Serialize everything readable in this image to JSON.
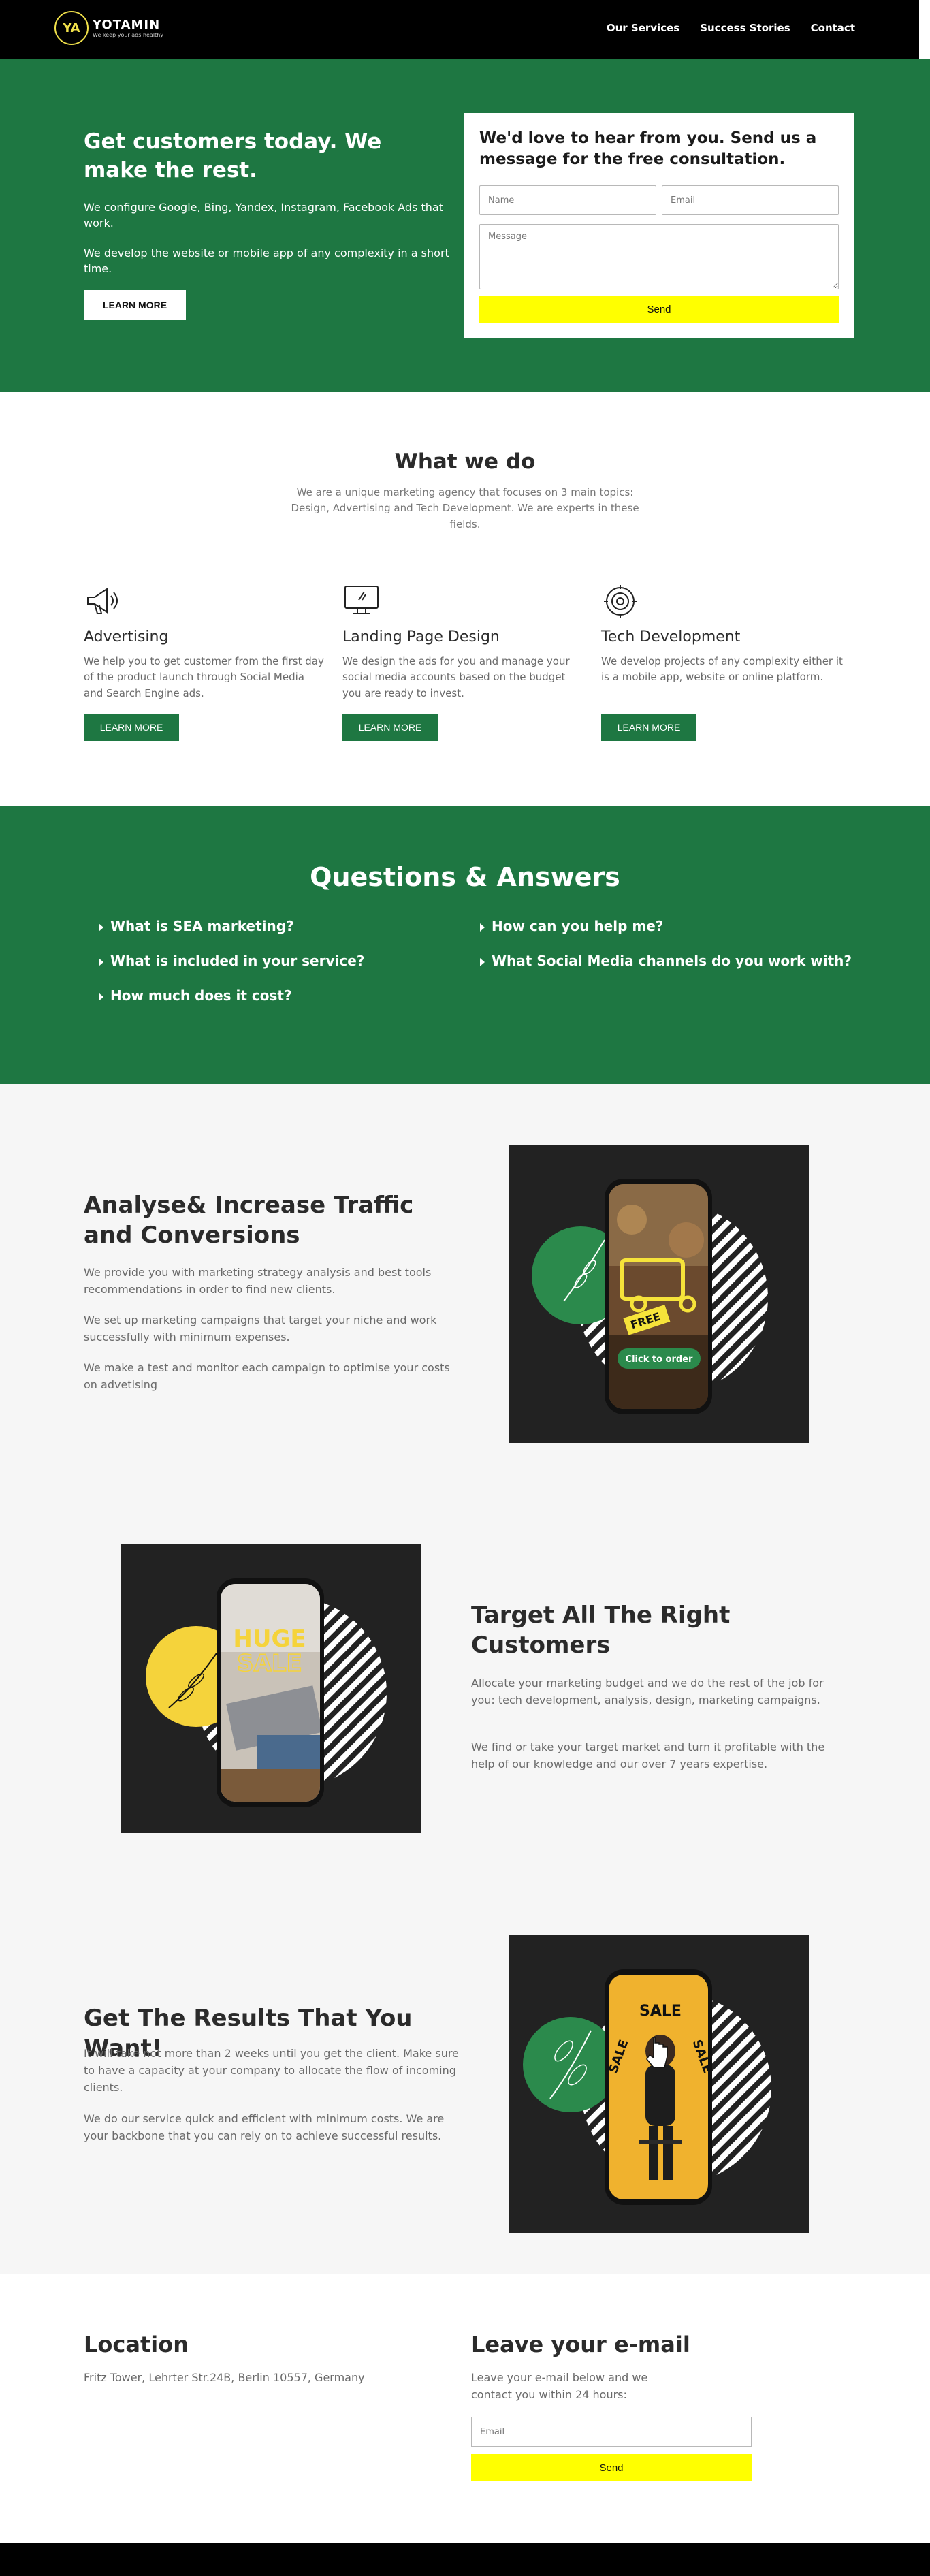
{
  "header": {
    "logo_mark": "YA",
    "logo_name": "YOTAMIN",
    "logo_tagline": "We keep your ads healthy",
    "nav": [
      "Our Services",
      "Success Stories",
      "Contact"
    ]
  },
  "hero": {
    "title": "Get customers today. We make the rest.",
    "p1": "We configure Google, Bing, Yandex, Instagram, Facebook Ads that work.",
    "p2": "We develop the website or mobile app of any complexity in a short time.",
    "button": "LEARN MORE"
  },
  "contact_form": {
    "title": "We'd love to hear from you. Send us a message for the free consultation.",
    "name_placeholder": "Name",
    "email_placeholder": "Email",
    "message_placeholder": "Message",
    "send": "Send"
  },
  "what_we_do": {
    "title": "What we do",
    "subtitle": "We are a unique marketing agency that focuses on 3 main topics: Design, Advertising and Tech Development. We are experts in these fields.",
    "services": [
      {
        "icon": "megaphone-icon",
        "title": "Advertising",
        "desc": "We help you to get customer from the first day of the product launch through Social Media and Search Engine ads.",
        "button": "LEARN MORE"
      },
      {
        "icon": "monitor-icon",
        "title": "Landing Page Design",
        "desc": "We design the ads for you and manage your social media accounts based on the budget you are ready to invest.",
        "button": "LEARN MORE"
      },
      {
        "icon": "gear-icon",
        "title": "Tech Development",
        "desc": "We develop projects of any complexity either it is a mobile app, website or online platform.",
        "button": "LEARN MORE"
      }
    ]
  },
  "qa": {
    "title": "Questions & Answers",
    "left": [
      "What is SEA marketing?",
      "What is included in your service?",
      "How much does it cost?"
    ],
    "right": [
      "How can you help me?",
      "What Social Media channels do you work with?"
    ]
  },
  "features": [
    {
      "title": "Analyse& Increase Traffic and Conversions",
      "paragraphs": [
        "We provide you with marketing strategy analysis and best tools recommendations in order to find new clients.",
        "We set up marketing campaigns that target your niche and work successfully with minimum expenses.",
        "We make a test and monitor each campaign to optimise your costs on advetising"
      ],
      "image": {
        "badge": "FREE",
        "cta": "Click to order"
      }
    },
    {
      "title": "Target All The Right Customers",
      "paragraphs": [
        "Allocate your marketing budget and we do the rest of the job for you: tech development, analysis, design, marketing campaigns.",
        "We find or take your target market and turn it profitable with the help of our knowledge and our over 7 years expertise."
      ],
      "image": {
        "line1": "HUGE",
        "line2": "SALE"
      }
    },
    {
      "title": "Get The Results That You Want!",
      "paragraphs": [
        "It will take not more than 2 weeks until you get the client. Make sure to have a capacity at your company to allocate the flow of incoming clients.",
        "We do our service quick and efficient with minimum costs. We are your backbone that you can rely on to achieve successful results."
      ],
      "image": {
        "word": "SALE"
      }
    }
  ],
  "location": {
    "title": "Location",
    "address": "Fritz Tower, Lehrter Str.24B, Berlin 10557, Germany"
  },
  "newsletter": {
    "title": "Leave your e-mail",
    "subtitle": "Leave your e-mail below and we contact you within 24 hours:",
    "placeholder": "Email",
    "send": "Send"
  },
  "colors": {
    "brand_green": "#1e7742",
    "accent_yellow": "#ffff00",
    "dark": "#000000"
  }
}
